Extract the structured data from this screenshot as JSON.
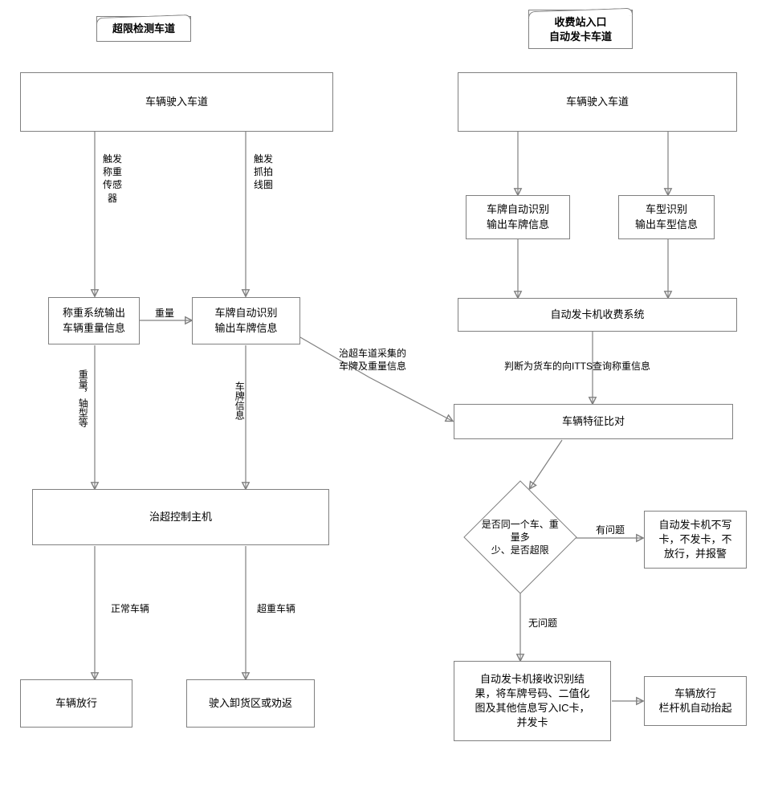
{
  "left": {
    "title": "超限检测车道",
    "entry": "车辆驶入车道",
    "entry_trigger_weight": "触发\n称重\n传感\n器",
    "entry_trigger_camera": "触发\n抓拍\n线圈",
    "weigh_out": "称重系统输出\n车辆重量信息",
    "lpr_out": "车牌自动识别\n输出车牌信息",
    "weight_to_lpr": "重量",
    "weight_axle_label": "重量，轴型等",
    "plate_info_label": "车牌信息",
    "host": "治超控制主机",
    "normal_label": "正常车辆",
    "over_label": "超重车辆",
    "release": "车辆放行",
    "reject": "驶入卸货区或劝返"
  },
  "right": {
    "title": "收费站入口\n自动发卡车道",
    "entry": "车辆驶入车道",
    "lpr": "车牌自动识别\n输出车牌信息",
    "vehtype": "车型识别\n输出车型信息",
    "auto_card": "自动发卡机收费系统",
    "query_label": "判断为货车的向ITTS查询称重信息",
    "compare": "车辆特征比对",
    "cross_label": "治超车道采集的\n车牌及重量信息",
    "decision": "是否同一个车、重量多\n少、是否超限",
    "problem_label": "有问题",
    "noproblem_label": "无问题",
    "alarm": "自动发卡机不写\n卡，不发卡，不\n放行，并报警",
    "write": "自动发卡机接收识别结\n果，将车牌号码、二值化\n图及其他信息写入IC卡，\n并发卡",
    "gate": "车辆放行\n栏杆机自动抬起"
  }
}
